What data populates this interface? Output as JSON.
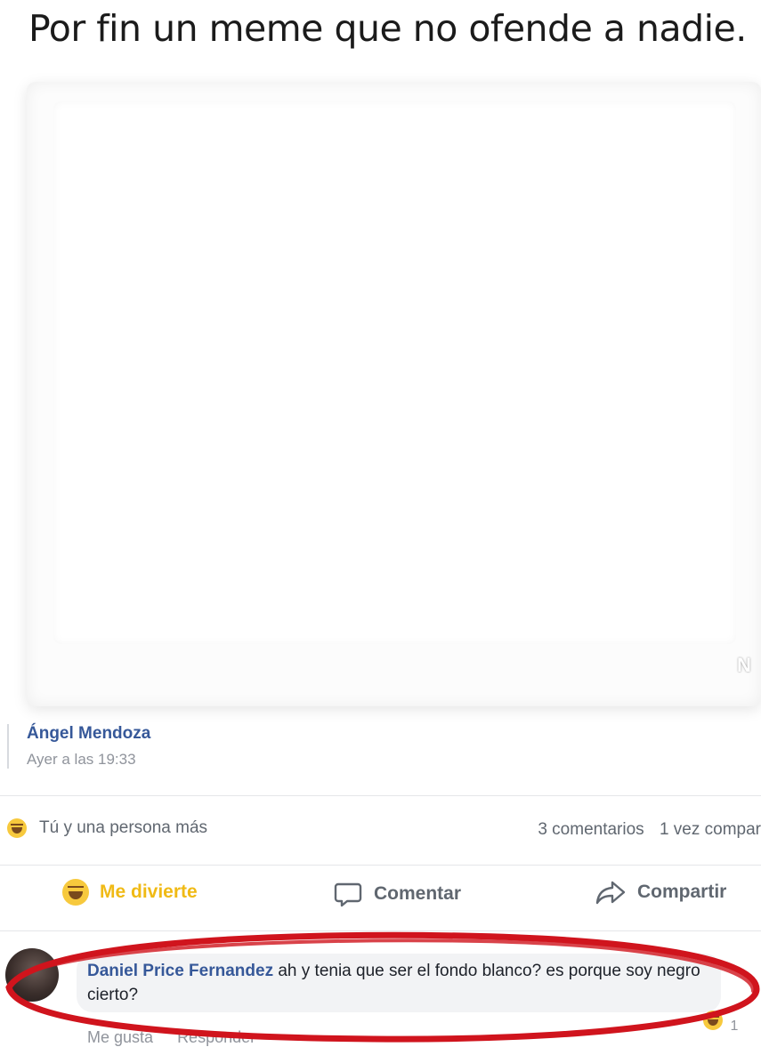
{
  "caption": "Por fin un meme que no ofende a nadie.",
  "watermark": "N",
  "post": {
    "author": "Ángel Mendoza",
    "timestamp": "Ayer a las 19:33"
  },
  "reactions": {
    "summary": "Tú y una persona más",
    "comments": "3 comentarios",
    "shares": "1 vez compar"
  },
  "actions": {
    "laugh": "Me divierte",
    "comment": "Comentar",
    "share": "Compartir"
  },
  "comment": {
    "author": "Daniel Price Fernandez",
    "text": "ah y tenia que ser el fondo blanco? es porque soy negro cierto?",
    "like": "Me gusta",
    "reply": "Responder",
    "reaction_count": "1"
  },
  "colors": {
    "link_blue": "#365899",
    "meta_gray": "#90949c",
    "laugh_yellow": "#f0ba15",
    "highlight_red": "#d0141d"
  },
  "icons": [
    "laugh-emoji-icon",
    "speech-bubble-icon",
    "share-arrow-icon"
  ]
}
